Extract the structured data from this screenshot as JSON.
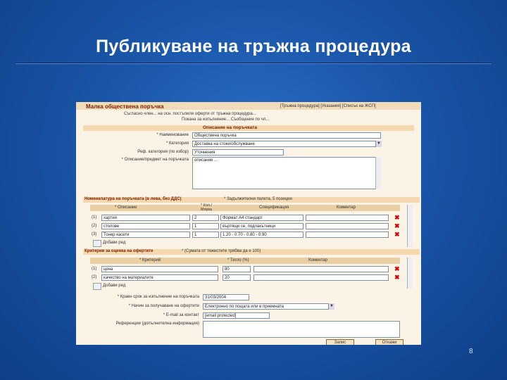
{
  "slide": {
    "title": "Публикуване на тръжна процедура",
    "page_number": "8"
  },
  "app": {
    "header_title": "Малка обществена поръчка",
    "header_links": "[Тръжна процедура] [Указания] [Списък на ЖСП]",
    "intro_line1": "Съгласно член... на осн. постъпили оферти от тръжна процедура...",
    "intro_line2": "Покана за изпълнение... Съобщение по чл..."
  },
  "description_section": {
    "title": "Описание на поръчката",
    "fields": [
      {
        "label": "* Наименование",
        "value": "Обществена поръчка"
      },
      {
        "label": "* Категория",
        "value": "Доставка на стоки/обслужване"
      },
      {
        "label": "Реф. категория (по избор)",
        "value": "Уточнения"
      },
      {
        "label": "* Описание/предмет на поръчката",
        "value": "описание ..."
      }
    ]
  },
  "lots_section": {
    "title": "Номенклатура на поръчката (в лева, без ДДС)",
    "note": "* Задължителни полета, 5 позиции",
    "columns": [
      "* Описание",
      "* Кол./ Мярка",
      "Спецификация",
      "Коментар"
    ],
    "rows": [
      {
        "num": "(1)",
        "name": "хартия",
        "qty": "2",
        "spec": "Формат А4 стандарт"
      },
      {
        "num": "(2)",
        "name": "столове",
        "qty": "1",
        "spec": "въртящи се, подлакътници"
      },
      {
        "num": "(3)",
        "name": "Тонер касети",
        "qty": "1",
        "spec": "1.20 - 0.70 - 0.80 - 0.90"
      }
    ],
    "add_label": "Добави ред"
  },
  "criteria_section": {
    "title": "Критерии за оценка на офертите",
    "note": "* (Сумата от тежестите трябва да е 100)",
    "columns": [
      "* Критерий",
      "* Тегло (%)",
      "Коментар"
    ],
    "rows": [
      {
        "num": "(1)",
        "name": "цена",
        "weight": "80"
      },
      {
        "num": "(2)",
        "name": "качество на материалите",
        "weight": "20"
      }
    ],
    "add_label": "Добави ред"
  },
  "footer_fields": [
    {
      "label": "* Краен срок за изпълнение на поръчката",
      "value": "31/03/2004"
    },
    {
      "label": "* Начин за получаване на офертите",
      "value": "Електронно по пощата или в приемната"
    },
    {
      "label": "* E-mail за контакт",
      "value": "[email protected]"
    },
    {
      "label": "Референции (допълнителна информация)",
      "value": ""
    }
  ],
  "buttons": {
    "save": "Запис",
    "cancel": "Откажи"
  },
  "colors": {
    "slide_bg": "#1a55a8",
    "panel_bg": "#fbf3e6",
    "header_accent": "#7a2200",
    "delete_icon": "#d40000"
  }
}
